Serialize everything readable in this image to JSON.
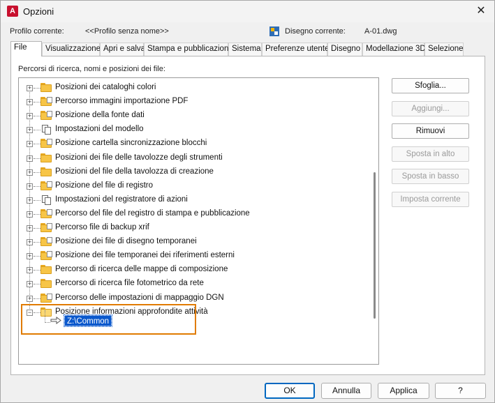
{
  "window": {
    "title": "Opzioni",
    "app_icon_letter": "A",
    "close_glyph": "✕"
  },
  "profile": {
    "current_profile_label": "Profilo corrente:",
    "current_profile_value": "<<Profilo senza nome>>",
    "current_drawing_label": "Disegno corrente:",
    "current_drawing_value": "A-01.dwg"
  },
  "tabs": [
    {
      "label": "File",
      "active": true
    },
    {
      "label": "Visualizzazione"
    },
    {
      "label": "Apri e salva"
    },
    {
      "label": "Stampa e pubblicazione"
    },
    {
      "label": "Sistema"
    },
    {
      "label": "Preferenze utente"
    },
    {
      "label": "Disegno"
    },
    {
      "label": "Modellazione 3D"
    },
    {
      "label": "Selezione"
    }
  ],
  "panel": {
    "label": "Percorsi di ricerca, nomi e posizioni dei file:"
  },
  "tree": {
    "items": [
      {
        "label": "Posizioni dei cataloghi colori",
        "icon": "folder-icon"
      },
      {
        "label": "Percorso immagini importazione PDF",
        "icon": "folder-file-icon"
      },
      {
        "label": "Posizione della fonte dati",
        "icon": "folder-file-icon"
      },
      {
        "label": "Impostazioni del modello",
        "icon": "settings-icon"
      },
      {
        "label": "Posizione cartella sincronizzazione blocchi",
        "icon": "folder-file-icon"
      },
      {
        "label": "Posizioni dei file delle tavolozze degli strumenti",
        "icon": "folder-icon"
      },
      {
        "label": "Posizioni del file della tavolozza di creazione",
        "icon": "folder-icon"
      },
      {
        "label": "Posizione del file di registro",
        "icon": "folder-file-icon"
      },
      {
        "label": "Impostazioni del registratore di azioni",
        "icon": "settings-icon"
      },
      {
        "label": "Percorso del file del registro di stampa e pubblicazione",
        "icon": "folder-file-icon"
      },
      {
        "label": "Percorso file di backup xrif",
        "icon": "folder-file-icon"
      },
      {
        "label": "Posizione dei file di disegno temporanei",
        "icon": "folder-file-icon"
      },
      {
        "label": "Posizione dei file temporanei dei riferimenti esterni",
        "icon": "folder-file-icon"
      },
      {
        "label": "Percorso di ricerca delle mappe di composizione",
        "icon": "folder-icon"
      },
      {
        "label": "Percorso di ricerca file fotometrico da rete",
        "icon": "folder-icon"
      },
      {
        "label": "Percorso delle impostazioni di mappaggio DGN",
        "icon": "folder-file-icon"
      },
      {
        "label": "Posizione informazioni approfondite attività",
        "icon": "folder-open-icon",
        "expanded": true
      }
    ],
    "child_value": "Z:\\Common",
    "expander_plus": "+",
    "expander_minus": "−"
  },
  "side_buttons": [
    {
      "label": "Sfoglia...",
      "enabled": true
    },
    {
      "label": "Aggiungi...",
      "enabled": false
    },
    {
      "label": "Rimuovi",
      "enabled": true
    },
    {
      "label": "Sposta in alto",
      "enabled": false
    },
    {
      "label": "Sposta in basso",
      "enabled": false
    },
    {
      "label": "Imposta corrente",
      "enabled": false
    }
  ],
  "bottom_buttons": {
    "ok": "OK",
    "cancel": "Annulla",
    "apply": "Applica",
    "help": "?"
  },
  "colors": {
    "accent": "#0067c0",
    "selection": "#0a58cc",
    "highlight_frame": "#e07b00",
    "brand": "#c8102e"
  }
}
